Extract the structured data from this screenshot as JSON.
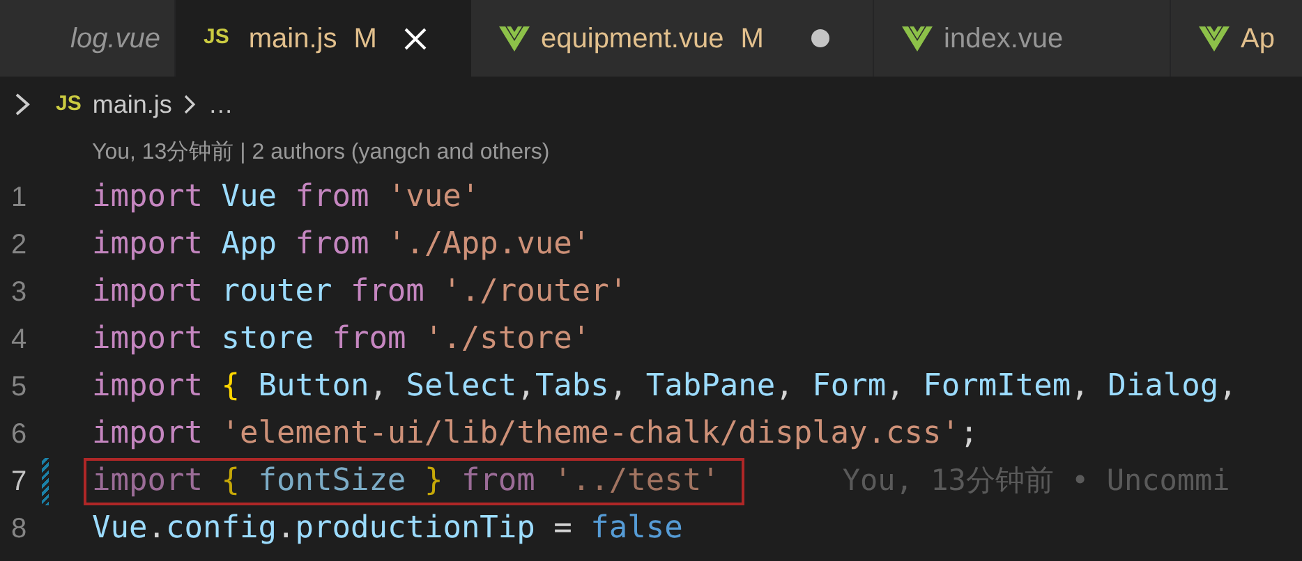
{
  "tabs": [
    {
      "label": "log.vue",
      "kind": "plain",
      "preview": true,
      "selected": false,
      "modified": false,
      "unsaved": false
    },
    {
      "label": "main.js",
      "kind": "js",
      "icon_text": "JS",
      "preview": false,
      "selected": true,
      "modified": true,
      "git_status": "M",
      "unsaved": false
    },
    {
      "label": "equipment.vue",
      "kind": "vue",
      "preview": false,
      "selected": false,
      "modified": true,
      "git_status": "M",
      "unsaved": true
    },
    {
      "label": "index.vue",
      "kind": "vue",
      "preview": false,
      "selected": false,
      "modified": false,
      "unsaved": false
    },
    {
      "label": "Ap",
      "kind": "vue",
      "preview": false,
      "selected": false,
      "modified": true,
      "unsaved": false
    }
  ],
  "breadcrumb": {
    "icon_text": "JS",
    "file": "main.js",
    "rest": "…"
  },
  "codelens": "You, 13分钟前 | 2 authors (yangch and others)",
  "lines": [
    {
      "number": "1",
      "boxed": false,
      "modified": false,
      "tokens": [
        {
          "kind": "keyword",
          "text": "import "
        },
        {
          "kind": "variable",
          "text": "Vue "
        },
        {
          "kind": "keyword",
          "text": "from "
        },
        {
          "kind": "string",
          "text": "'vue'"
        }
      ]
    },
    {
      "number": "2",
      "boxed": false,
      "modified": false,
      "tokens": [
        {
          "kind": "keyword",
          "text": "import "
        },
        {
          "kind": "variable",
          "text": "App "
        },
        {
          "kind": "keyword",
          "text": "from "
        },
        {
          "kind": "string",
          "text": "'./App.vue'"
        }
      ]
    },
    {
      "number": "3",
      "boxed": false,
      "modified": false,
      "tokens": [
        {
          "kind": "keyword",
          "text": "import "
        },
        {
          "kind": "variable",
          "text": "router "
        },
        {
          "kind": "keyword",
          "text": "from "
        },
        {
          "kind": "string",
          "text": "'./router'"
        }
      ]
    },
    {
      "number": "4",
      "boxed": false,
      "modified": false,
      "tokens": [
        {
          "kind": "keyword",
          "text": "import "
        },
        {
          "kind": "variable",
          "text": "store "
        },
        {
          "kind": "keyword",
          "text": "from "
        },
        {
          "kind": "string",
          "text": "'./store'"
        }
      ]
    },
    {
      "number": "5",
      "boxed": false,
      "modified": false,
      "tokens": [
        {
          "kind": "keyword",
          "text": "import "
        },
        {
          "kind": "brace",
          "text": "{ "
        },
        {
          "kind": "variable",
          "text": "Button"
        },
        {
          "kind": "plain",
          "text": ", "
        },
        {
          "kind": "variable",
          "text": "Select"
        },
        {
          "kind": "plain",
          "text": ","
        },
        {
          "kind": "variable",
          "text": "Tabs"
        },
        {
          "kind": "plain",
          "text": ", "
        },
        {
          "kind": "variable",
          "text": "TabPane"
        },
        {
          "kind": "plain",
          "text": ", "
        },
        {
          "kind": "variable",
          "text": "Form"
        },
        {
          "kind": "plain",
          "text": ", "
        },
        {
          "kind": "variable",
          "text": "FormItem"
        },
        {
          "kind": "plain",
          "text": ", "
        },
        {
          "kind": "variable",
          "text": "Dialog"
        },
        {
          "kind": "plain",
          "text": ","
        }
      ]
    },
    {
      "number": "6",
      "boxed": false,
      "modified": false,
      "tokens": [
        {
          "kind": "keyword",
          "text": "import "
        },
        {
          "kind": "string",
          "text": "'element-ui/lib/theme-chalk/display.css'"
        },
        {
          "kind": "plain",
          "text": ";"
        }
      ]
    },
    {
      "number": "7",
      "boxed": true,
      "modified": true,
      "blame": "You, 13分钟前 • Uncommi",
      "tokens": [
        {
          "kind": "keyword",
          "text": "import "
        },
        {
          "kind": "brace",
          "text": "{ "
        },
        {
          "kind": "variable",
          "text": "fontSize "
        },
        {
          "kind": "brace",
          "text": "} "
        },
        {
          "kind": "keyword",
          "text": "from "
        },
        {
          "kind": "string",
          "text": "'../test'"
        }
      ]
    },
    {
      "number": "8",
      "boxed": false,
      "modified": false,
      "tokens": [
        {
          "kind": "variable",
          "text": "Vue"
        },
        {
          "kind": "plain",
          "text": "."
        },
        {
          "kind": "variable",
          "text": "config"
        },
        {
          "kind": "plain",
          "text": "."
        },
        {
          "kind": "variable",
          "text": "productionTip"
        },
        {
          "kind": "plain",
          "text": " = "
        },
        {
          "kind": "boolean",
          "text": "false"
        }
      ]
    }
  ]
}
